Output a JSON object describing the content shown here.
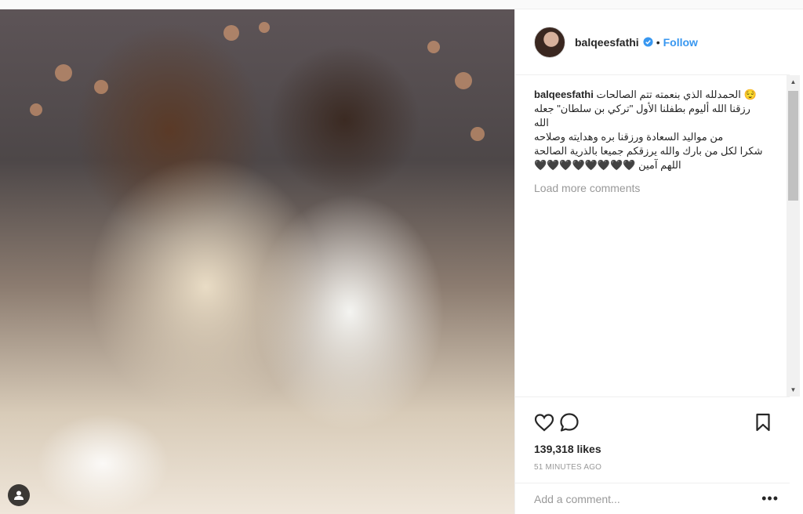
{
  "post": {
    "username": "balqeesfathi",
    "separator": "•",
    "follow_label": "Follow",
    "caption_user": "balqeesfathi",
    "caption_lines": [
      "الحمدلله الذي بنعمته تتم الصالحات 😌",
      "رزقنا الله أليوم بطفلنا الأول \"تركي بن سلطان\" جعله الله",
      "من مواليد السعادة ورزقنا بره وهدايته وصلاحه",
      "شكرا لكل من بارك والله يرزقكم جميعا بالذرية الصالحة",
      "اللهم آمين 🖤🖤🖤🖤🖤🖤🖤🖤"
    ],
    "load_more_label": "Load more comments",
    "likes": "139,318 likes",
    "timestamp": "51 MINUTES AGO",
    "comment_placeholder": "Add a comment...",
    "more_label": "•••"
  },
  "icons": {
    "verified": "verified-badge-icon",
    "like": "heart-icon",
    "comment": "comment-bubble-icon",
    "save": "bookmark-icon",
    "user_tag": "user-tag-icon",
    "more": "more-options-icon"
  },
  "colors": {
    "link": "#3897f0",
    "text": "#262626",
    "muted": "#999999",
    "border": "#efefef"
  }
}
